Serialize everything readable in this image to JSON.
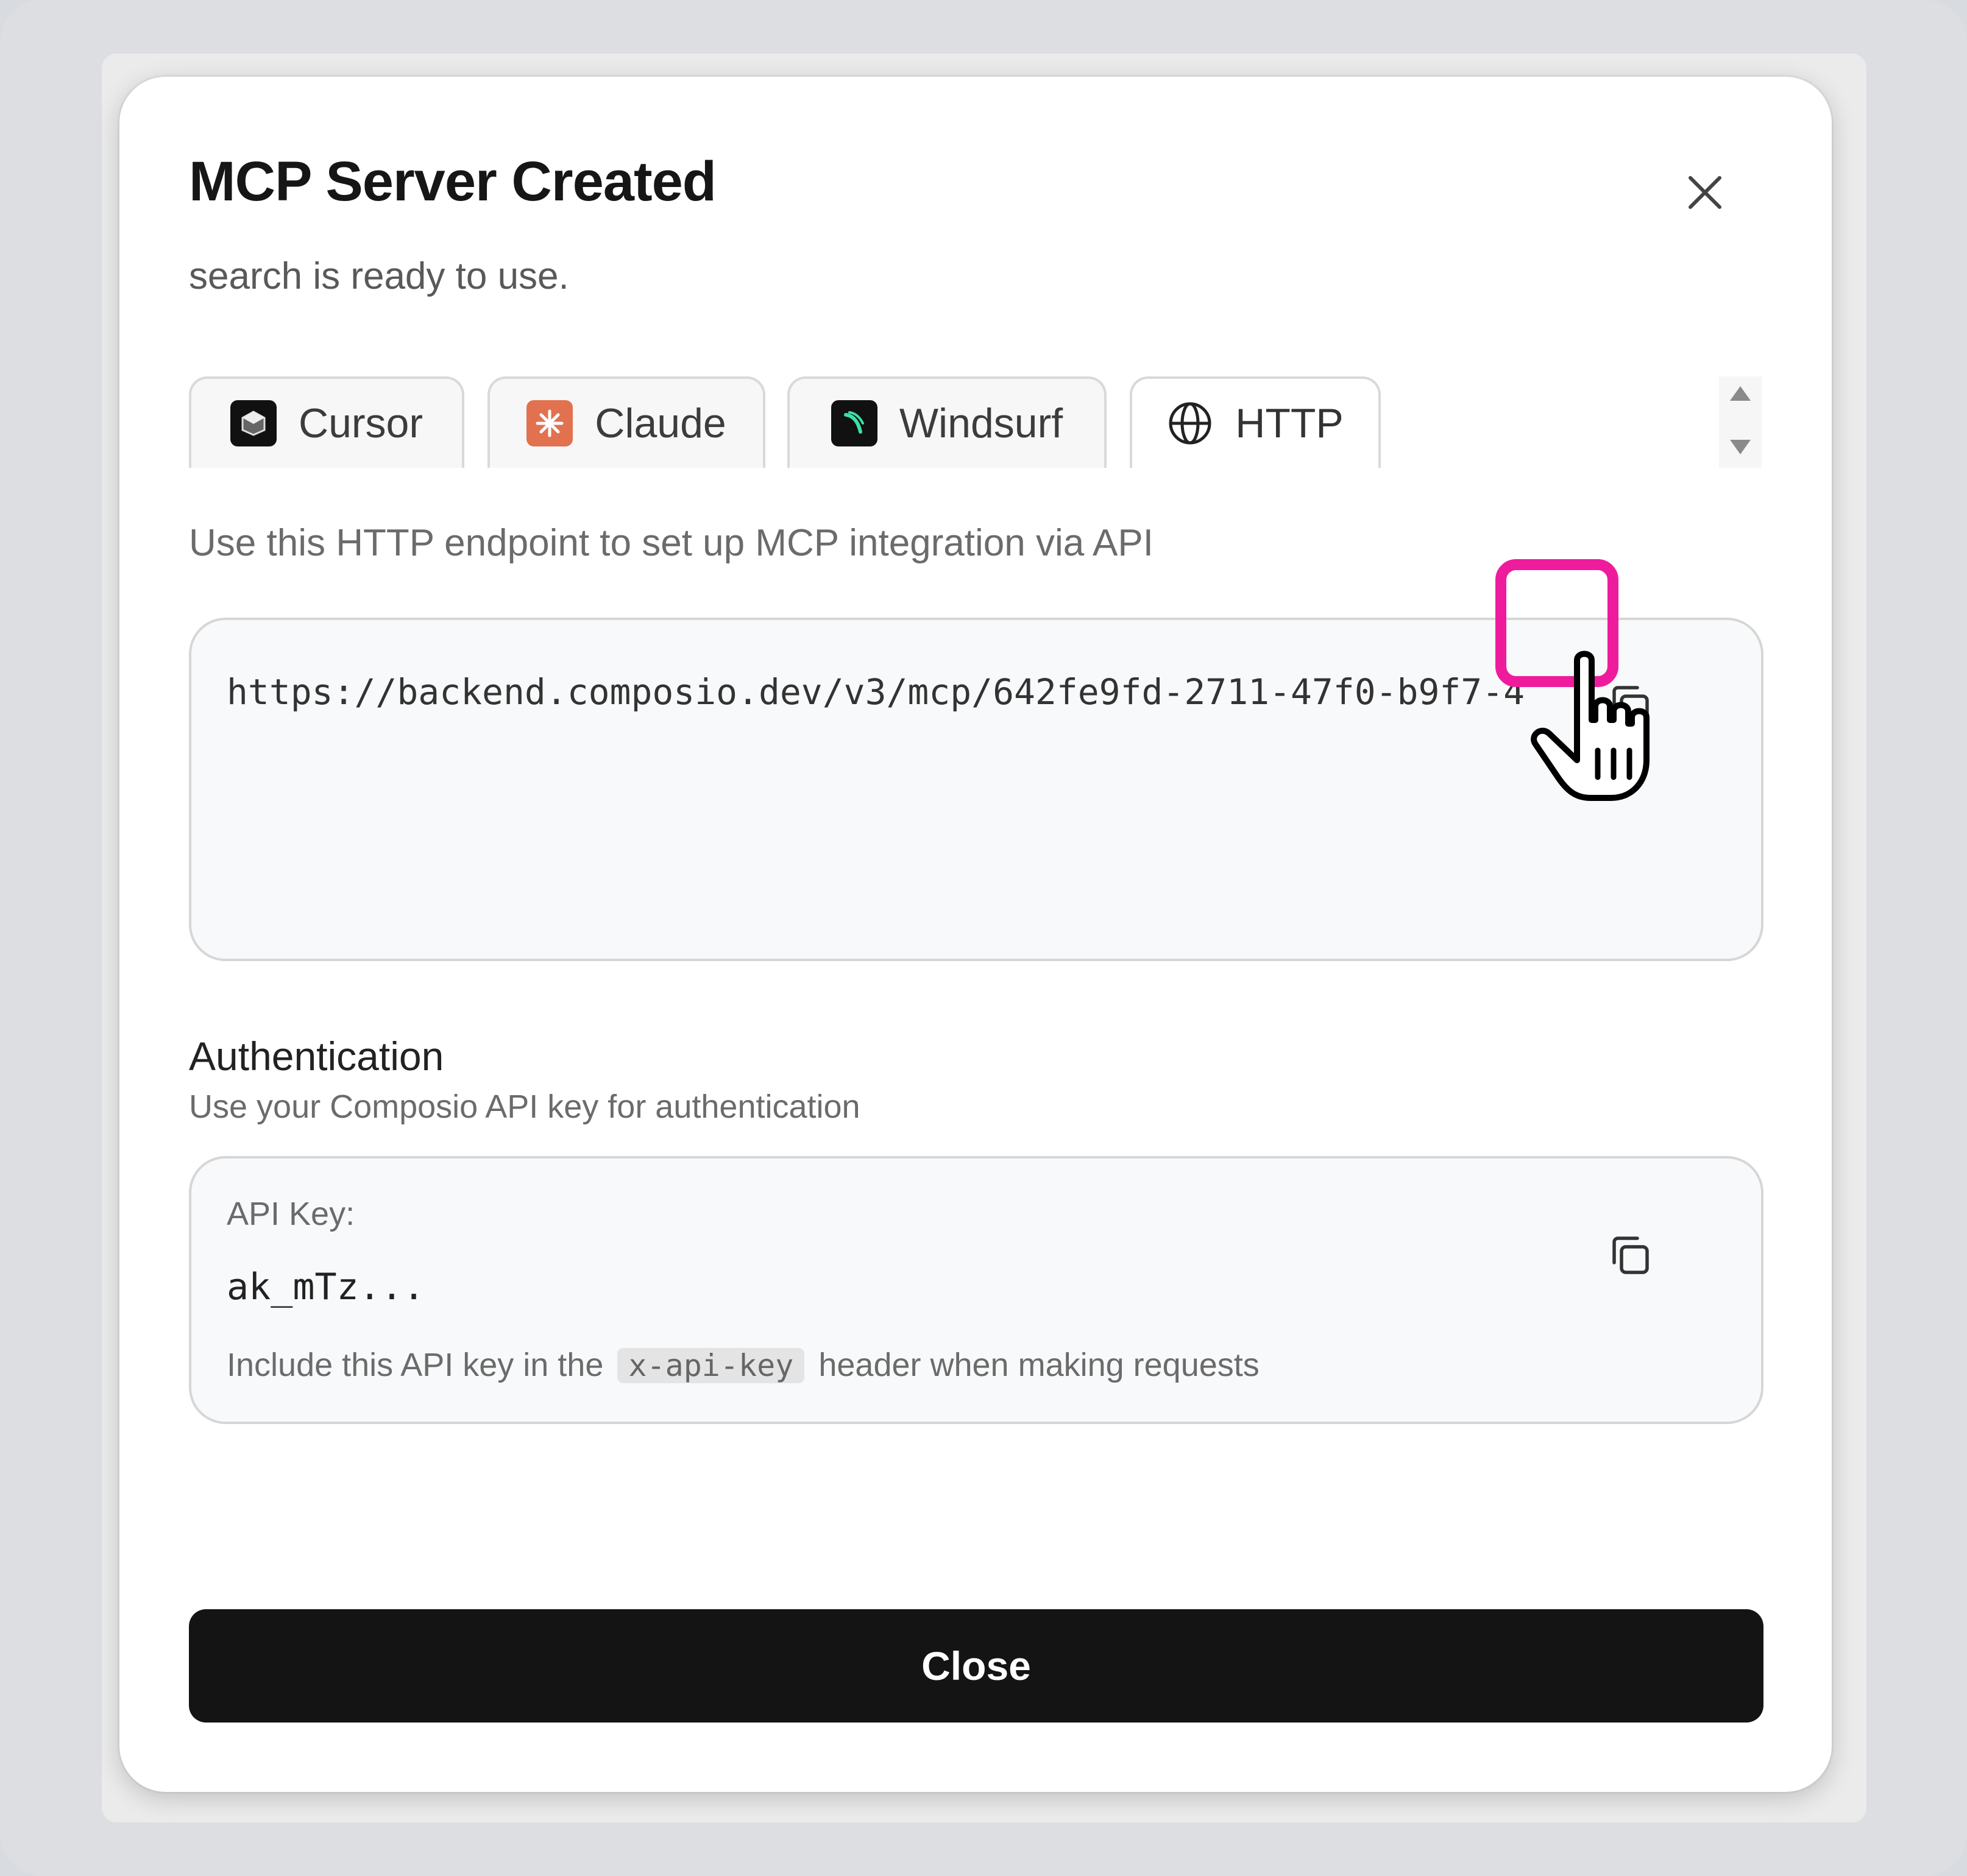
{
  "dialog": {
    "title": "MCP Server Created",
    "subtitle": "search is ready to use.",
    "close_icon": "close-icon"
  },
  "tabs": [
    {
      "label": "Cursor",
      "icon": "cursor-logo-icon",
      "active": false
    },
    {
      "label": "Claude",
      "icon": "claude-logo-icon",
      "active": false
    },
    {
      "label": "Windsurf",
      "icon": "windsurf-logo-icon",
      "active": false
    },
    {
      "label": "HTTP",
      "icon": "globe-icon",
      "active": true
    }
  ],
  "http": {
    "description": "Use this HTTP endpoint to set up MCP integration via API",
    "endpoint_url": "https://backend.composio.dev/v3/mcp/642fe9fd-2711-47f0-b9f7-4"
  },
  "auth": {
    "title": "Authentication",
    "subtitle": "Use your Composio API key for authentication",
    "key_label": "API Key:",
    "key_value": "ak_mTz...",
    "hint_before": "Include this API key in the",
    "hint_code": "x-api-key",
    "hint_after": "header when making requests"
  },
  "footer": {
    "close_label": "Close"
  },
  "colors": {
    "highlight": "#ee1c9c",
    "primary_button": "#141414",
    "claude_brand": "#e2714f",
    "windsurf_brand": "#3ee0a5"
  }
}
